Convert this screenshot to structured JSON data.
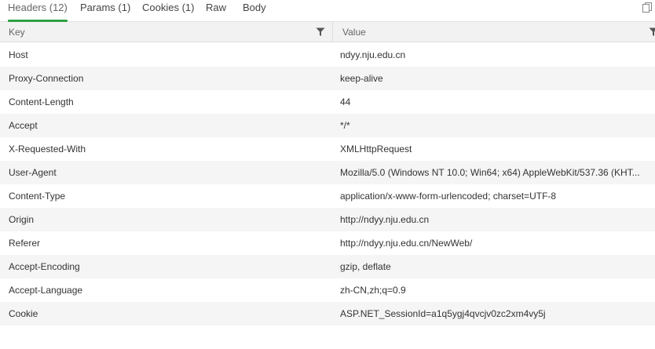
{
  "tabs": [
    {
      "label": "Headers (12)"
    },
    {
      "label": "Params (1)"
    },
    {
      "label": "Cookies (1)"
    },
    {
      "label": "Raw"
    },
    {
      "label": "Body"
    }
  ],
  "table": {
    "columns": [
      {
        "label": "Key"
      },
      {
        "label": "Value"
      }
    ],
    "rows": [
      {
        "key": "Host",
        "value": "ndyy.nju.edu.cn"
      },
      {
        "key": "Proxy-Connection",
        "value": "keep-alive"
      },
      {
        "key": "Content-Length",
        "value": "44"
      },
      {
        "key": "Accept",
        "value": "*/*"
      },
      {
        "key": "X-Requested-With",
        "value": "XMLHttpRequest"
      },
      {
        "key": "User-Agent",
        "value": "Mozilla/5.0 (Windows NT 10.0; Win64; x64) AppleWebKit/537.36 (KHT..."
      },
      {
        "key": "Content-Type",
        "value": "application/x-www-form-urlencoded; charset=UTF-8"
      },
      {
        "key": "Origin",
        "value": "http://ndyy.nju.edu.cn"
      },
      {
        "key": "Referer",
        "value": "http://ndyy.nju.edu.cn/NewWeb/"
      },
      {
        "key": "Accept-Encoding",
        "value": "gzip, deflate"
      },
      {
        "key": "Accept-Language",
        "value": "zh-CN,zh;q=0.9"
      },
      {
        "key": "Cookie",
        "value": "ASP.NET_SessionId=a1q5ygj4qvcjv0zc2xm4vy5j"
      }
    ]
  },
  "icons": {
    "copy": "copy-icon",
    "filter": "filter-icon"
  },
  "colors": {
    "active_tab_underline": "#2ea043",
    "alt_row": "#f5f5f5",
    "header_bg": "#f2f2f2"
  }
}
